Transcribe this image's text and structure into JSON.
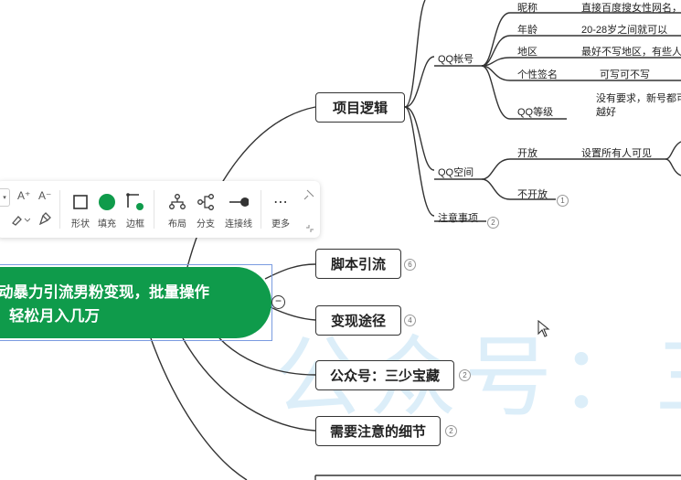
{
  "watermark": "公众号：三",
  "root": {
    "line1": "动暴力引流男粉变现，批量操作",
    "line2": "轻松月入几万",
    "collapse_symbol": "−",
    "color": "#0f9b4b"
  },
  "branches": [
    {
      "label": "项目逻辑",
      "badge": ""
    },
    {
      "label": "脚本引流",
      "badge": "6"
    },
    {
      "label": "变现途径",
      "badge": "4"
    },
    {
      "label": "公众号：三少宝藏",
      "badge": "2"
    },
    {
      "label": "需要注意的细节",
      "badge": "2"
    }
  ],
  "logic": {
    "qq_account": "QQ帐号",
    "qq_space": "QQ空间",
    "notes": "注意事项",
    "notes_badge": "2",
    "items": [
      {
        "label": "昵称",
        "value": "直接百度搜女性网名，取"
      },
      {
        "label": "年龄",
        "value": "20-28岁之间就可以"
      },
      {
        "label": "地区",
        "value": "最好不写地区，有些人表"
      },
      {
        "label": "个性签名",
        "value": "可写可不写"
      },
      {
        "label": "QQ等级",
        "value_line1": "没有要求，新号都可",
        "value_line2": "越好"
      }
    ],
    "space_open": "开放",
    "space_open_value": "设置所有人可见",
    "space_closed": "不开放",
    "space_closed_badge": "1"
  },
  "toolbar": {
    "font_increase": "A⁺",
    "font_decrease": "A⁻",
    "items": [
      {
        "label": "形状"
      },
      {
        "label": "填充"
      },
      {
        "label": "边框"
      },
      {
        "label": "布局"
      },
      {
        "label": "分支"
      },
      {
        "label": "连接线"
      },
      {
        "label": "更多"
      }
    ],
    "fill_color": "#0f9b4b",
    "more_icon": "⋯"
  }
}
